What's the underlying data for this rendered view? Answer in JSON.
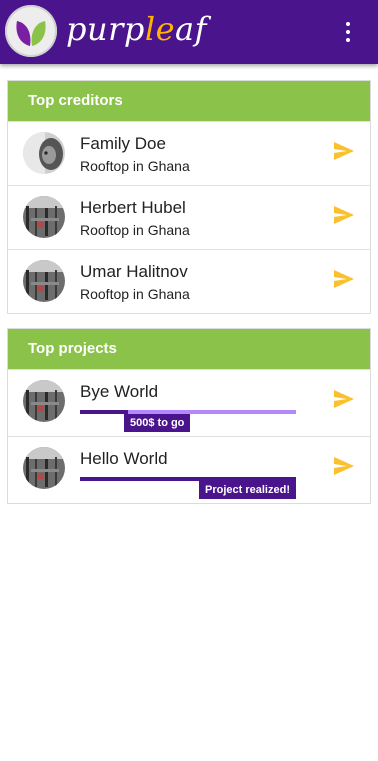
{
  "app": {
    "brand_prefix": "purp",
    "brand_highlight": "le",
    "brand_suffix": "af",
    "menu_icon": "more-vert-icon",
    "colors": {
      "primary": "#4a148c",
      "accent": "#ffb300",
      "section_header": "#8bc34a",
      "progress_track": "#b388ff"
    }
  },
  "creditors": {
    "header": "Top creditors",
    "items": [
      {
        "name": "Family Doe",
        "subtitle": "Rooftop in Ghana",
        "avatar": "portrait-photo"
      },
      {
        "name": "Herbert Hubel",
        "subtitle": "Rooftop in Ghana",
        "avatar": "rooftop-photo"
      },
      {
        "name": "Umar Halitnov",
        "subtitle": "Rooftop in Ghana",
        "avatar": "rooftop-photo"
      }
    ]
  },
  "projects": {
    "header": "Top projects",
    "items": [
      {
        "name": "Bye World",
        "progress": 0.22,
        "badge": "500$ to go",
        "avatar": "rooftop-photo"
      },
      {
        "name": "Hello World",
        "progress": 1.0,
        "badge": "Project realized!",
        "avatar": "rooftop-photo"
      }
    ]
  }
}
